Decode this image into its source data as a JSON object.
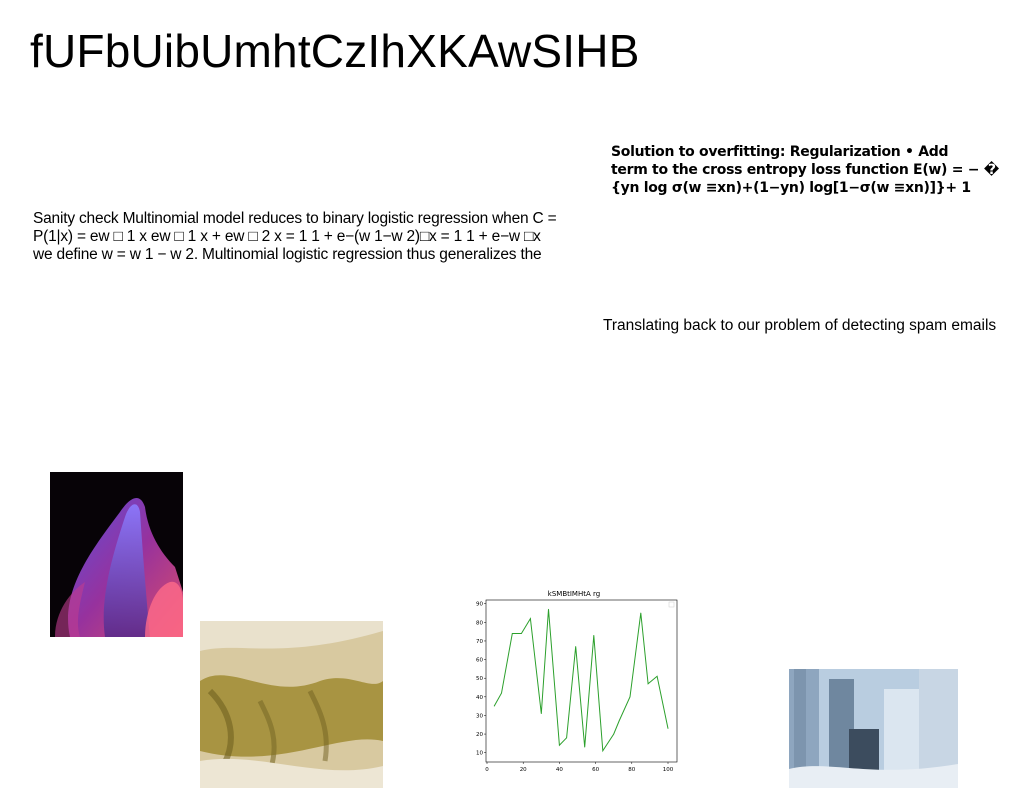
{
  "page": {
    "title": "fUFbUibUmhtCzIhXKAwSIHB"
  },
  "left_paragraph": {
    "lines": [
      "Sanity check Multinomial model reduces to binary logistic regression when C =",
      "P(1|x) = ew □ 1 x ew □ 1 x + ew □ 2 x = 1 1 + e−(w 1−w 2)□x = 1 1 + e−w □x",
      "we define w = w 1 − w 2. Multinomial logistic regression thus generalizes the"
    ]
  },
  "right_paragraph": {
    "lines": [
      "Solution to overfitting: Regularization • Add",
      "term to the cross entropy loss function E(w) = − �",
      "{yn log σ(w ≡xn)+(1−yn) log[1−σ(w ≡xn)]}+ 1"
    ]
  },
  "caption": {
    "text": "Translating back to our problem of detecting spam emails"
  },
  "images": {
    "flame": "abstract-flame-image",
    "sand": "sand-texture-image",
    "ruins": "ruins-photo-image"
  },
  "chart_data": {
    "type": "line",
    "title": "kSMBtIMHtA rg",
    "color": "#2ca02c",
    "x": [
      4,
      8,
      14,
      19,
      24,
      30,
      34,
      40,
      44,
      49,
      54,
      59,
      64,
      70,
      73,
      79,
      85,
      89,
      94,
      100
    ],
    "y": [
      35,
      42,
      74,
      74,
      82,
      31,
      87,
      14,
      18,
      67,
      13,
      73,
      11,
      20,
      27,
      40,
      85,
      47,
      51,
      23
    ],
    "xlim": [
      0,
      100
    ],
    "ylim": [
      10,
      90
    ],
    "xticks": [
      0,
      20,
      40,
      60,
      80,
      100
    ],
    "yticks": [
      10,
      20,
      30,
      40,
      50,
      60,
      70,
      80,
      90
    ],
    "grid": false,
    "legend": "top-right"
  }
}
